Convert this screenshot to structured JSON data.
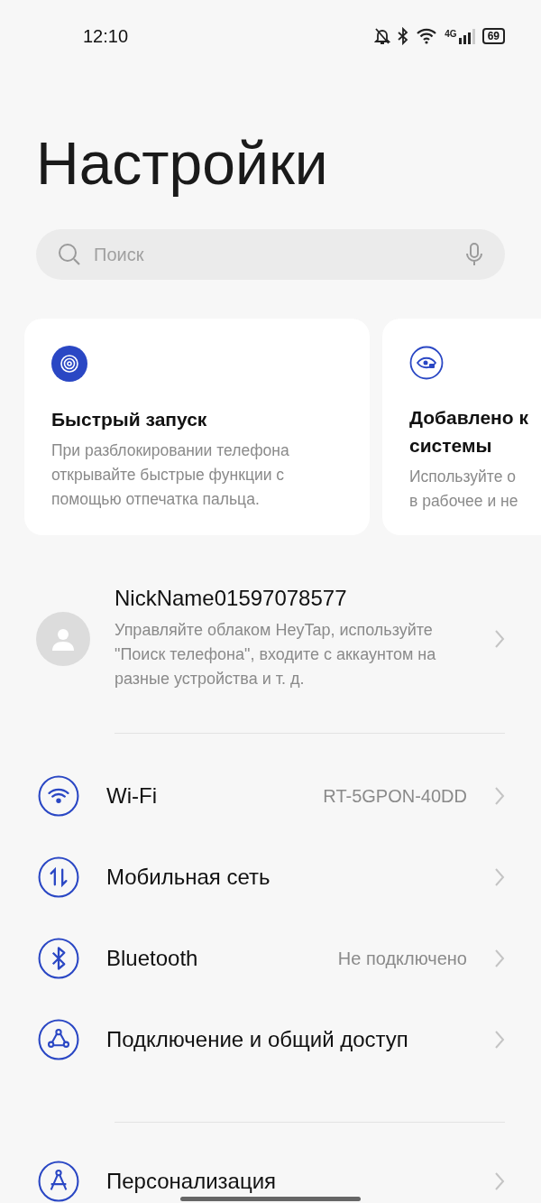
{
  "status_bar": {
    "time": "12:10",
    "network": "4G",
    "battery": "69"
  },
  "title": "Настройки",
  "search": {
    "placeholder": "Поиск"
  },
  "cards": [
    {
      "kind": "fingerprint",
      "title": "Быстрый запуск",
      "description": "При разблокировании телефона открывайте быстрые функции с помощью отпечатка пальца."
    },
    {
      "kind": "eye",
      "title": "Добавлено к\nсистемы",
      "description": "Используйте о\nв рабочее и не"
    }
  ],
  "account": {
    "name": "NickName01597078577",
    "description": "Управляйте облаком HeyTap, используйте \"Поиск телефона\", входите с аккаунтом на разные устройства и т. д."
  },
  "groups": [
    [
      {
        "kind": "wifi",
        "label": "Wi-Fi",
        "value": "RT-5GPON-40DD"
      },
      {
        "kind": "mobile",
        "label": "Мобильная сеть"
      },
      {
        "kind": "bluetooth",
        "label": "Bluetooth",
        "value": "Не подключено"
      },
      {
        "kind": "share",
        "label": "Подключение и общий доступ"
      }
    ],
    [
      {
        "kind": "compass",
        "label": "Персонализация"
      }
    ]
  ]
}
